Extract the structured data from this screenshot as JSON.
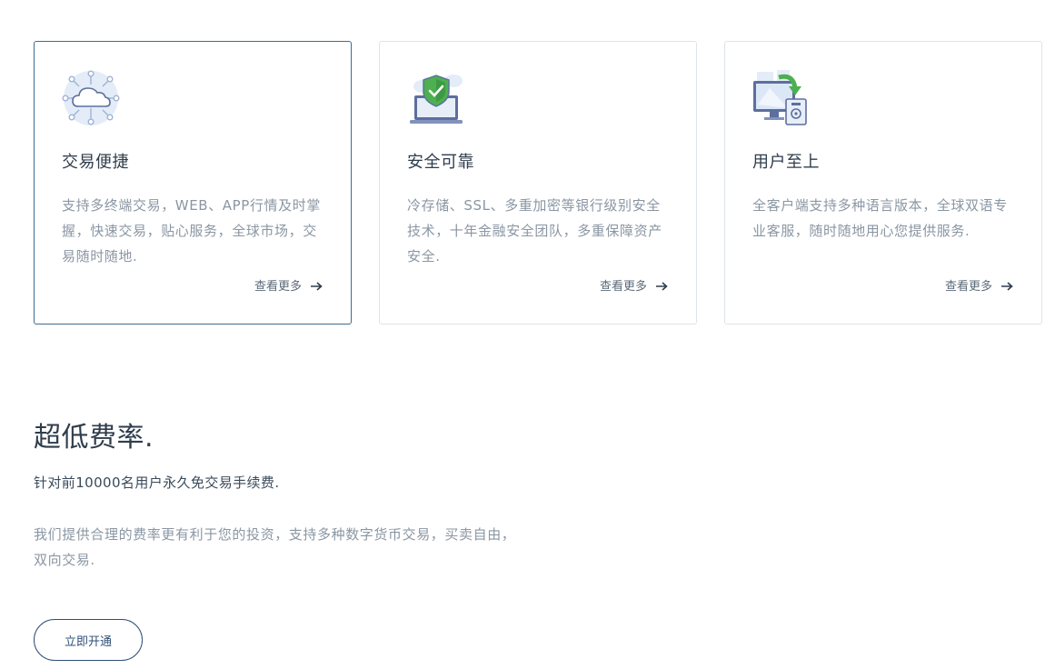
{
  "features": [
    {
      "icon": "cloud-network-icon",
      "title": "交易便捷",
      "description": "支持多终端交易，WEB、APP行情及时掌握，快速交易，贴心服务，全球市场，交易随时随地.",
      "more_label": "查看更多",
      "active": true
    },
    {
      "icon": "shield-laptop-icon",
      "title": "安全可靠",
      "description": "冷存储、SSL、多重加密等银行级别安全技术，十年金融安全团队，多重保障资产安全.",
      "more_label": "查看更多",
      "active": false
    },
    {
      "icon": "monitor-sync-icon",
      "title": "用户至上",
      "description": "全客户端支持多种语言版本，全球双语专业客服，随时随地用心您提供服务.",
      "more_label": "查看更多",
      "active": false
    }
  ],
  "fees": {
    "title": "超低费率.",
    "subtitle": "针对前10000名用户永久免交易手续费.",
    "description": "我们提供合理的费率更有利于您的投资，支持多种数字货币交易，买卖自由，双向交易.",
    "cta_label": "立即开通"
  },
  "colors": {
    "active_border": "#3d6d92",
    "card_border": "#dde4ea",
    "button_border": "#2f4f78"
  }
}
